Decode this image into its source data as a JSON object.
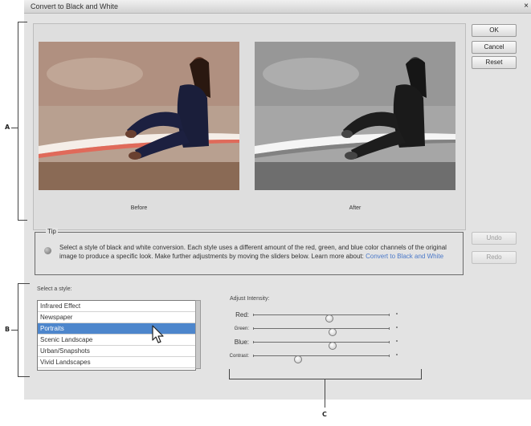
{
  "window": {
    "title": "Convert to Black and White",
    "close_glyph": "×"
  },
  "buttons": {
    "ok": "OK",
    "cancel": "Cancel",
    "reset": "Reset",
    "undo": "Undo",
    "redo": "Redo"
  },
  "preview": {
    "before_label": "Before",
    "after_label": "After"
  },
  "tip": {
    "legend": "Tip",
    "text": "Select a style of black and white conversion. Each style uses a different amount of the red, green, and blue color channels of the original image to produce a specific look. Make further adjustments by moving the sliders below. Learn more about:",
    "link": "Convert to Black and White"
  },
  "style_selector": {
    "label": "Select a style:",
    "items": [
      "Infrared Effect",
      "Newspaper",
      "Portraits",
      "Scenic Landscape",
      "Urban/Snapshots",
      "Vivid Landscapes"
    ],
    "selected_index": 2
  },
  "intensity": {
    "label": "Adjust Intensity:",
    "sliders": [
      {
        "label": "Red:",
        "value": 0.56
      },
      {
        "label": "Green:",
        "value": 0.58
      },
      {
        "label": "Blue:",
        "value": 0.58
      },
      {
        "label": "Contrast:",
        "value": 0.33
      }
    ]
  },
  "callouts": {
    "a": "A",
    "b": "B",
    "c": "C"
  },
  "colors": {
    "selection": "#4d86cc",
    "link": "#4a78c8",
    "dialog_bg": "#e3e3e3"
  },
  "icons": [
    "close-icon",
    "info-icon",
    "pointer-cursor-icon"
  ]
}
